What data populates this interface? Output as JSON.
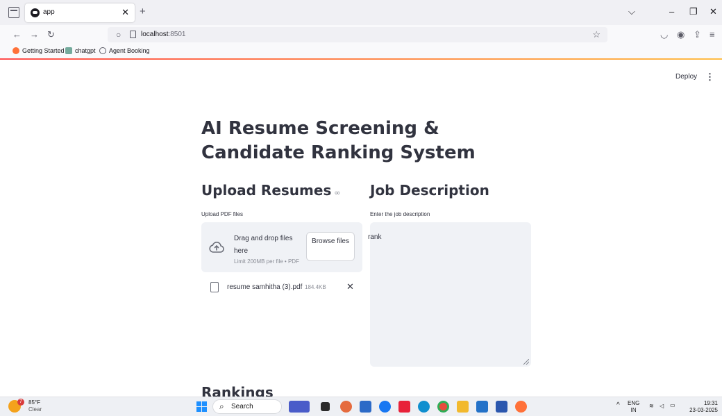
{
  "browser": {
    "tab_title": "app",
    "url_host": "localhost",
    "url_port": ":8501",
    "bookmarks": [
      {
        "label": "Getting Started",
        "icon": "firefox-icon",
        "color": "#ff7139"
      },
      {
        "label": "chatgpt",
        "icon": "chatgpt-icon",
        "color": "#74aa9c"
      },
      {
        "label": "Agent Booking",
        "icon": "globe-icon",
        "color": "#5b5b66"
      }
    ]
  },
  "app": {
    "deploy_label": "Deploy",
    "title": "AI Resume Screening & Candidate Ranking System",
    "upload_heading": "Upload Resumes",
    "upload_label": "Upload PDF files",
    "dropzone_text": "Drag and drop files here",
    "dropzone_limit": "Limit 200MB per file • PDF",
    "browse_label": "Browse files",
    "uploaded_file": {
      "name": "resume samhitha (3).pdf",
      "size": "184.4KB"
    },
    "jd_heading": "Job Description",
    "jd_label": "Enter the job description",
    "jd_value": "rank",
    "rankings_heading": "Rankings",
    "accent_color": "#ff4b4b"
  },
  "taskbar": {
    "temperature": "85°F",
    "condition": "Clear",
    "weather_badge": "7",
    "search_placeholder": "Search",
    "language": "ENG",
    "region": "IN",
    "time": "19:31",
    "date": "23-03-2025"
  }
}
